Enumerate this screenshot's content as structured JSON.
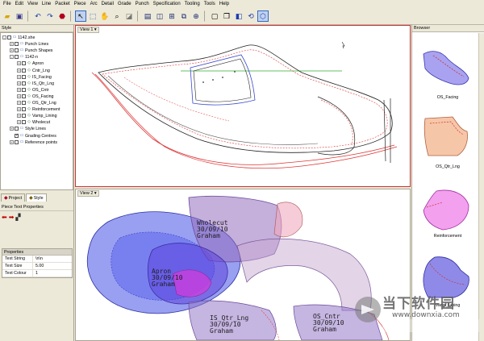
{
  "menu": [
    "File",
    "Edit",
    "View",
    "Line",
    "Packet",
    "Piece",
    "Arc",
    "Detail",
    "Grade",
    "Punch",
    "Specification",
    "Tooling",
    "Tools",
    "Help"
  ],
  "toolbar": {
    "icons": [
      "open-folder-icon",
      "save-icon",
      "undo-icon",
      "redo-icon",
      "stop-icon",
      "pointer-icon",
      "select-icon",
      "grab-icon",
      "zoom-icon",
      "eraser-icon",
      "split-h-icon",
      "split-v-icon",
      "grid-icon",
      "fit-icon",
      "crosshair-icon",
      "page-icon",
      "copy-icon",
      "mirror-icon",
      "rotate-icon",
      "grade-icon"
    ]
  },
  "style_panel": {
    "title": "Style",
    "tree": [
      {
        "label": "1142.she",
        "level": 0,
        "expand": "-",
        "checked": false,
        "icon": "file-icon"
      },
      {
        "label": "Punch Lines",
        "level": 1,
        "expand": "+",
        "checked": false,
        "icon": "punch-lines-icon"
      },
      {
        "label": "Punch Shapes",
        "level": 1,
        "expand": "+",
        "checked": false,
        "icon": "punch-shapes-icon"
      },
      {
        "label": "1142-n",
        "level": 1,
        "expand": "-",
        "checked": false,
        "icon": "piece-set-icon"
      },
      {
        "label": "Apron",
        "level": 2,
        "expand": "+",
        "checked": false,
        "icon": "piece-icon"
      },
      {
        "label": "Cntr_Lng",
        "level": 2,
        "expand": "+",
        "checked": false,
        "icon": "piece-icon"
      },
      {
        "label": "IS_Facing",
        "level": 2,
        "expand": "+",
        "checked": false,
        "icon": "piece-icon"
      },
      {
        "label": "IS_Qtr_Lng",
        "level": 2,
        "expand": "+",
        "checked": false,
        "icon": "piece-icon"
      },
      {
        "label": "OS_Cntr",
        "level": 2,
        "expand": "+",
        "checked": false,
        "icon": "piece-icon"
      },
      {
        "label": "OS_Facing",
        "level": 2,
        "expand": "+",
        "checked": false,
        "icon": "piece-icon"
      },
      {
        "label": "OS_Qtr_Lng",
        "level": 2,
        "expand": "+",
        "checked": false,
        "icon": "piece-icon"
      },
      {
        "label": "Reinforcement",
        "level": 2,
        "expand": "+",
        "checked": false,
        "icon": "piece-icon"
      },
      {
        "label": "Vamp_Lining",
        "level": 2,
        "expand": "+",
        "checked": false,
        "icon": "piece-icon"
      },
      {
        "label": "Wholecut",
        "level": 2,
        "expand": "+",
        "checked": false,
        "icon": "piece-icon"
      },
      {
        "label": "Style Lines",
        "level": 1,
        "expand": "+",
        "checked": false,
        "icon": "style-lines-icon"
      },
      {
        "label": "Grading Centres",
        "level": 1,
        "expand": "",
        "checked": true,
        "icon": "grading-icon"
      },
      {
        "label": "Reference points",
        "level": 1,
        "expand": "+",
        "checked": false,
        "icon": "reference-icon"
      }
    ]
  },
  "tabs": [
    {
      "label": "Project",
      "active": false
    },
    {
      "label": "Style",
      "active": true
    }
  ],
  "piece_text_panel": {
    "title": "Piece Text Properties",
    "header": "Properties",
    "rows": [
      {
        "key": "Text String",
        "value": "\\n\\n"
      },
      {
        "key": "Text Size",
        "value": "5.00"
      },
      {
        "key": "Text Colour",
        "value": "1"
      }
    ]
  },
  "view1": {
    "label": "View 1 ▾"
  },
  "view2": {
    "label": "View 2 ▾",
    "pieces": [
      {
        "lines": "Wholecut\n30/09/10\nGraham"
      },
      {
        "lines": "Apron\n30/09/10\nGraham"
      },
      {
        "lines": "IS_Qtr_Lng\n30/09/10\nGraham"
      },
      {
        "lines": "OS_Cntr\n30/09/10\nGraham"
      }
    ]
  },
  "browser": {
    "title": "Browser",
    "items": [
      {
        "label": "OS_Facing",
        "color": "#a9a2f0"
      },
      {
        "label": "OS_Qtr_Lng",
        "color": "#f6c6a8"
      },
      {
        "label": "Reinforcement",
        "color": "#f3a0ee"
      },
      {
        "label": "Vamp_Lining",
        "color": "#8f8ae8"
      }
    ]
  },
  "watermark": {
    "text": "当下软件园",
    "url": "www.downxia.com"
  }
}
